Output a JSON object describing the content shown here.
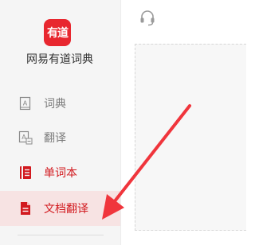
{
  "app": {
    "logo_text": "有道",
    "name": "网易有道词典"
  },
  "nav": {
    "items": [
      {
        "label": "词典",
        "icon": "dictionary-icon",
        "state": "inactive"
      },
      {
        "label": "翻译",
        "icon": "translate-icon",
        "state": "inactive"
      },
      {
        "label": "单词本",
        "icon": "wordbook-icon",
        "state": "highlighted"
      },
      {
        "label": "文档翻译",
        "icon": "document-icon",
        "state": "selected"
      }
    ]
  },
  "header": {
    "icon": "headset-icon"
  },
  "annotation": {
    "type": "arrow",
    "color": "#f0353c",
    "points_to": "文档翻译"
  },
  "colors": {
    "brand": "#e8272f",
    "sidebar_bg": "#f5f5f5",
    "selected_bg": "#f7e3e3",
    "active_text": "#d21a1f",
    "inactive_text": "#7c7c7c"
  }
}
